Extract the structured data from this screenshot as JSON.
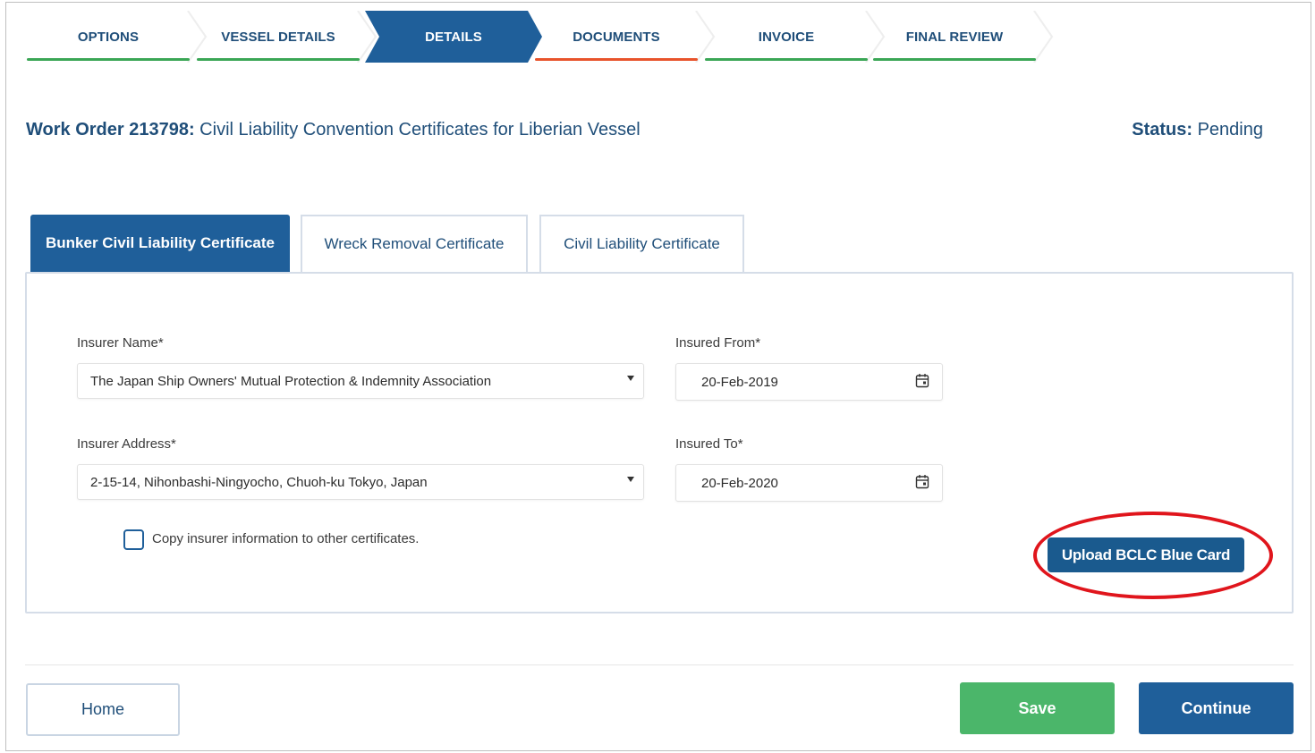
{
  "stepper": {
    "steps": [
      {
        "label": "OPTIONS",
        "underline_color": "#3aa655"
      },
      {
        "label": "VESSEL DETAILS",
        "underline_color": "#3aa655"
      },
      {
        "label": "DETAILS",
        "active": true
      },
      {
        "label": "DOCUMENTS",
        "underline_color": "#e8532b"
      },
      {
        "label": "INVOICE",
        "underline_color": "#3aa655"
      },
      {
        "label": "FINAL REVIEW",
        "underline_color": "#3aa655"
      }
    ]
  },
  "header": {
    "work_order_prefix": "Work Order 213798:",
    "work_order_title": " Civil Liability Convention Certificates for Liberian Vessel",
    "status_label": "Status:",
    "status_value": " Pending"
  },
  "tabs": [
    {
      "label": "Bunker Civil Liability Certificate",
      "active": true
    },
    {
      "label": "Wreck Removal Certificate"
    },
    {
      "label": "Civil Liability Certificate"
    }
  ],
  "form": {
    "insurer_name_label": "Insurer Name*",
    "insurer_name_value": "The Japan Ship Owners' Mutual Protection & Indemnity Association",
    "insurer_address_label": "Insurer Address*",
    "insurer_address_value": "2-15-14, Nihonbashi-Ningyocho, Chuoh-ku Tokyo, Japan",
    "insured_from_label": "Insured From*",
    "insured_from_value": "20-Feb-2019",
    "insured_to_label": "Insured To*",
    "insured_to_value": "20-Feb-2020",
    "copy_checkbox_label": "Copy insurer information to other certificates.",
    "copy_checked": false,
    "upload_button_label": "Upload BCLC Blue Card"
  },
  "footer": {
    "home_label": "Home",
    "save_label": "Save",
    "continue_label": "Continue"
  },
  "colors": {
    "primary": "#1f5f9a",
    "success": "#4bb66a",
    "annotation": "#e0151c"
  }
}
